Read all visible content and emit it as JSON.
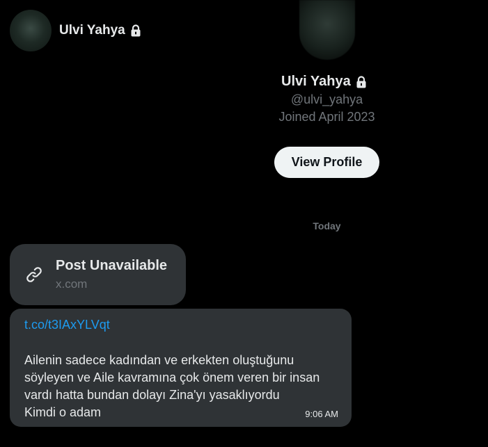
{
  "header": {
    "name": "Ulvi Yahya"
  },
  "profile": {
    "name": "Ulvi Yahya",
    "handle": "@ulvi_yahya",
    "joined": "Joined April 2023",
    "view_profile_label": "View Profile"
  },
  "conversation": {
    "date_divider": "Today",
    "link_card": {
      "title": "Post Unavailable",
      "domain": "x.com",
      "icon": "link-icon"
    },
    "message": {
      "link": "t.co/t3IAxYLVqt",
      "lines": [
        "Ailenin sadece kadından ve erkekten oluştuğunu",
        "söyleyen ve Aile kavramına çok önem veren bir insan",
        "vardı hatta bundan dolayı Zina'yı yasaklıyordu",
        "Kimdi o adam"
      ],
      "time": "9:06 AM"
    }
  },
  "colors": {
    "background": "#000000",
    "bubble": "#2f3336",
    "text": "#e7e9ea",
    "muted": "#71767b",
    "link": "#1d9bf0",
    "button_bg": "#eff3f4"
  }
}
